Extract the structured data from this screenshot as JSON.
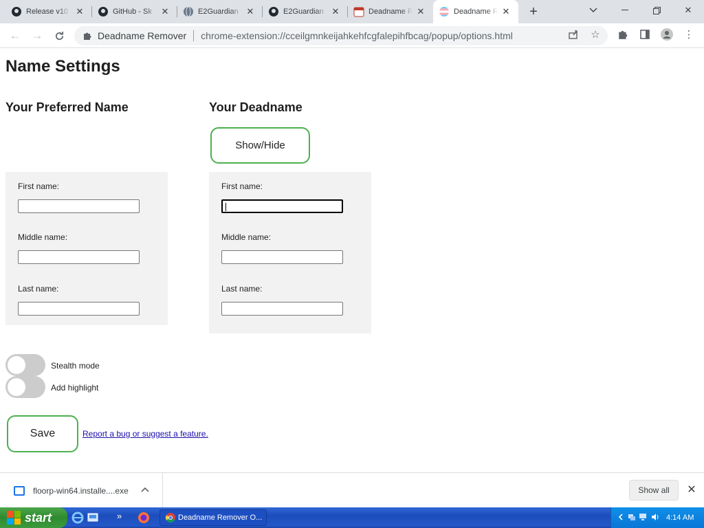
{
  "browser": {
    "tabs": [
      {
        "title": "Release v10",
        "icon": "github-icon"
      },
      {
        "title": "GitHub - Sk",
        "icon": "github-icon"
      },
      {
        "title": "E2Guardian",
        "icon": "globe-icon"
      },
      {
        "title": "E2Guardian",
        "icon": "github-icon"
      },
      {
        "title": "Deadname R",
        "icon": "calendar-icon"
      },
      {
        "title": "Deadname R",
        "icon": "trans-flag-icon"
      }
    ],
    "omnibox": {
      "site_name": "Deadname Remover",
      "url": "chrome-extension://cceilgmnkeijahkehfcgfalepihfbcag/popup/options.html"
    }
  },
  "page": {
    "title": "Name Settings",
    "preferred": {
      "heading": "Your Preferred Name",
      "first_label": "First name:",
      "middle_label": "Middle name:",
      "last_label": "Last name:",
      "first_value": "",
      "middle_value": "",
      "last_value": ""
    },
    "deadname": {
      "heading": "Your Deadname",
      "show_hide_label": "Show/Hide",
      "first_label": "First name:",
      "middle_label": "Middle name:",
      "last_label": "Last name:",
      "first_value": "",
      "middle_value": "",
      "last_value": ""
    },
    "toggles": {
      "stealth_label": "Stealth mode",
      "stealth_on": false,
      "highlight_label": "Add highlight",
      "highlight_on": false
    },
    "save_label": "Save",
    "report_link": "Report a bug or suggest a feature."
  },
  "downloads": {
    "file_name": "floorp-win64.installe....exe",
    "show_all": "Show all"
  },
  "taskbar": {
    "start_label": "start",
    "task_title": "Deadname Remover O...",
    "clock": "4:14 AM"
  },
  "colors": {
    "accent_green": "#4caf50",
    "link": "#1a0dab",
    "panel_bg": "#f2f2f2"
  }
}
